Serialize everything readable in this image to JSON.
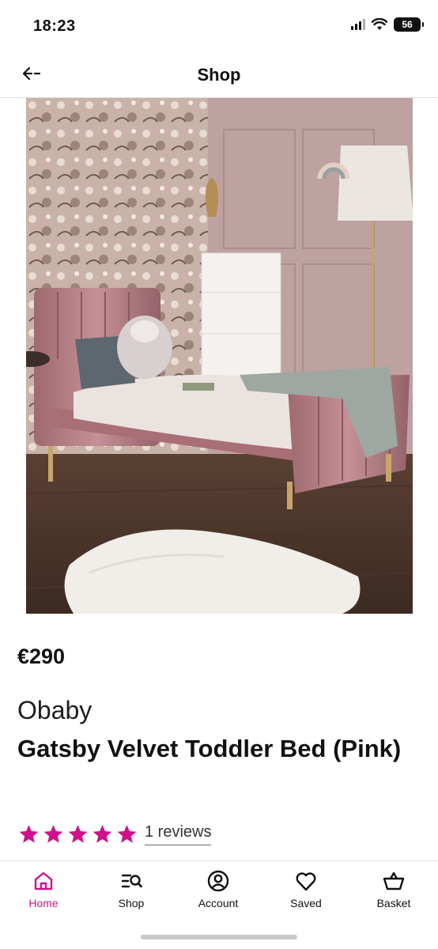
{
  "status_bar": {
    "time": "18:23",
    "battery": "56"
  },
  "nav": {
    "title": "Shop"
  },
  "product": {
    "price": "€290",
    "brand": "Obaby",
    "title": "Gatsby Velvet Toddler Bed (Pink)",
    "rating": 5,
    "reviews_label": "1 reviews"
  },
  "tabs": [
    {
      "label": "Home",
      "icon": "home-icon",
      "active": true
    },
    {
      "label": "Shop",
      "icon": "shop-search-icon",
      "active": false
    },
    {
      "label": "Account",
      "icon": "account-icon",
      "active": false
    },
    {
      "label": "Saved",
      "icon": "heart-icon",
      "active": false
    },
    {
      "label": "Basket",
      "icon": "basket-icon",
      "active": false
    }
  ],
  "colors": {
    "accent": "#d1108c",
    "star": "#d1108c"
  }
}
